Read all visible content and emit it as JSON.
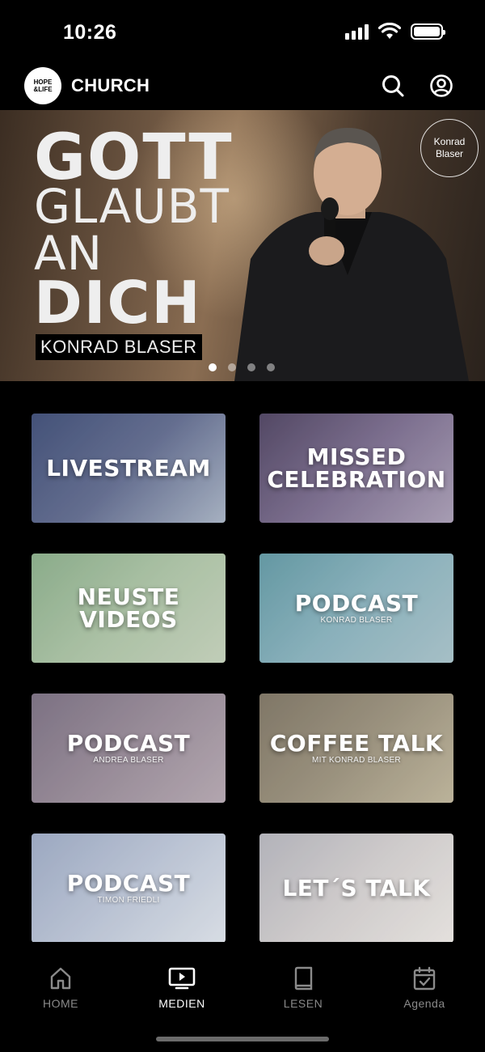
{
  "status_bar": {
    "time": "10:26"
  },
  "header": {
    "logo_top": "HOPE",
    "logo_bottom": "&LIFE",
    "brand": "CHURCH",
    "search_icon": "search-icon",
    "profile_icon": "user-circle-icon"
  },
  "hero": {
    "line1": "GOTT",
    "line2": "GLAUBT",
    "line3": "AN",
    "line4": "DICH",
    "speaker": "KONRAD BLASER",
    "badge_line1": "Konrad",
    "badge_line2": "Blaser",
    "dots_total": 4,
    "active_dot": 1
  },
  "tiles": [
    {
      "title_line1": "LIVESTREAM",
      "title_line2": "",
      "subtitle": ""
    },
    {
      "title_line1": "MISSED",
      "title_line2": "CELEBRATION",
      "subtitle": ""
    },
    {
      "title_line1": "NEUSTE",
      "title_line2": "VIDEOS",
      "subtitle": ""
    },
    {
      "title_line1": "PODCAST",
      "title_line2": "",
      "subtitle": "KONRAD BLASER"
    },
    {
      "title_line1": "PODCAST",
      "title_line2": "",
      "subtitle": "ANDREA BLASER"
    },
    {
      "title_line1": "COFFEE TALK",
      "title_line2": "",
      "subtitle": "MIT KONRAD BLASER"
    },
    {
      "title_line1": "PODCAST",
      "title_line2": "",
      "subtitle": "TIMON FRIEDLI"
    },
    {
      "title_line1": "LET´S TALK",
      "title_line2": "",
      "subtitle": ""
    }
  ],
  "nav": [
    {
      "label": "HOME",
      "icon": "home-icon",
      "active": false
    },
    {
      "label": "MEDIEN",
      "icon": "tv-play-icon",
      "active": true
    },
    {
      "label": "LESEN",
      "icon": "book-icon",
      "active": false
    },
    {
      "label": "Agenda",
      "icon": "calendar-check-icon",
      "active": false
    }
  ]
}
